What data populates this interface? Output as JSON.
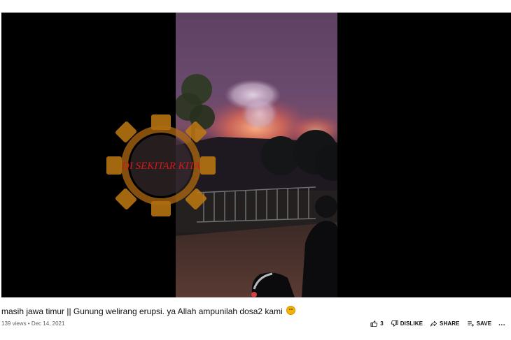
{
  "video": {
    "watermark_text": "DI SEKITAR KITA",
    "title": "masih jawa timur || Gunung welirang erupsi. ya Allah ampunilah dosa2 kami",
    "title_emoji": "pleading-face-emoji",
    "meta": "139 views • Dec 14, 2021"
  },
  "actions": {
    "like_count": "3",
    "dislike_label": "DISLIKE",
    "share_label": "SHARE",
    "save_label": "SAVE",
    "more_label": "..."
  },
  "icons": {
    "like": "thumbs-up-icon",
    "dislike": "thumbs-down-icon",
    "share": "share-icon",
    "save": "save-playlist-icon"
  },
  "colors": {
    "text": "#0f0f0f",
    "meta": "#606060",
    "logo_gear": "#c07a12",
    "logo_text": "#d11a1a"
  }
}
